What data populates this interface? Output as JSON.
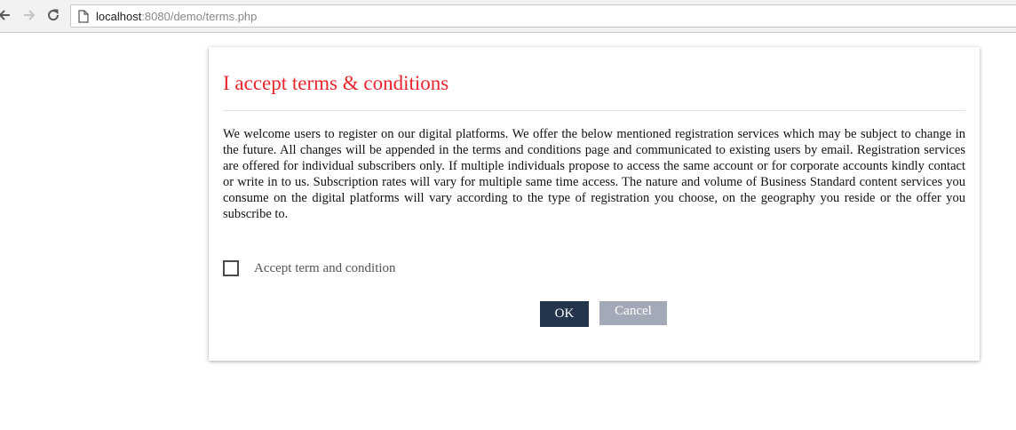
{
  "browser": {
    "url_host": "localhost",
    "url_rest": ":8080/demo/terms.php"
  },
  "dialog": {
    "title": "I accept terms & conditions",
    "body": "We welcome users to register on our digital platforms. We offer the below mentioned registration services which may be subject to change in the future. All changes will be appended in the terms and conditions page and communicated to existing users by email. Registration services are offered for individual subscribers only. If multiple individuals propose to access the same account or for corporate accounts kindly contact or write in to us. Subscription rates will vary for multiple same time access. The nature and volume of Business Standard content services you consume on the digital platforms will vary according to the type of registration you choose, on the geography you reside or the offer you subscribe to.",
    "checkbox_label": "Accept term and condition",
    "checkbox_checked": false,
    "ok_label": "OK",
    "cancel_label": "Cancel"
  },
  "colors": {
    "title": "#e8262d",
    "ok_button": "#24354b",
    "cancel_button": "#a4a9b7"
  },
  "icons": {
    "back": "arrow-left-icon",
    "forward": "arrow-right-icon",
    "reload": "reload-icon",
    "page": "page-icon"
  }
}
